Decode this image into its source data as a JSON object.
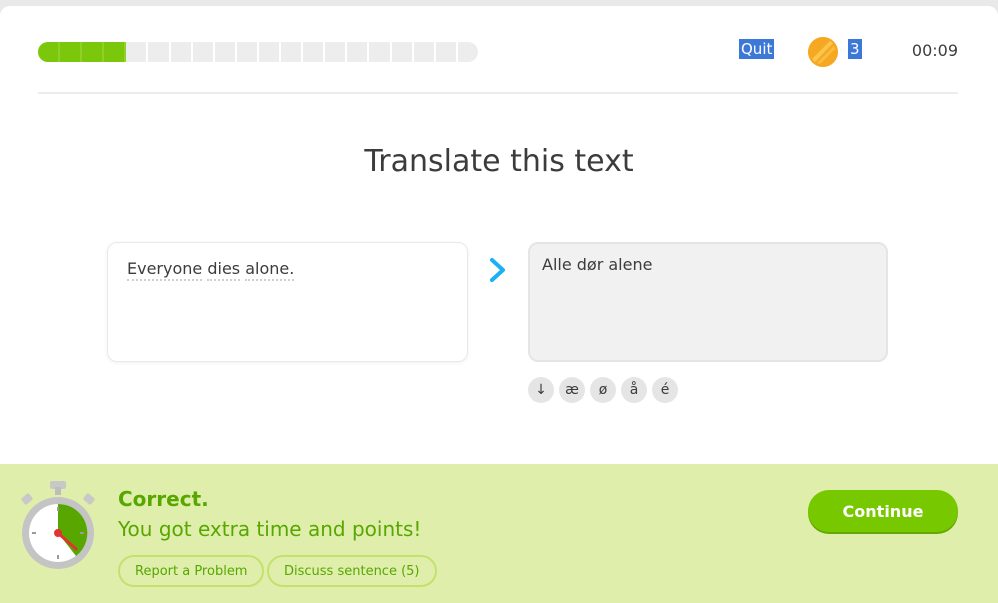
{
  "header": {
    "progress": {
      "total_segments": 20,
      "completed_segments": 4
    },
    "quit_label": "Quit",
    "coin_count": "3",
    "timer": "00:09"
  },
  "exercise": {
    "heading": "Translate this text",
    "prompt_words": [
      "Everyone",
      "dies",
      "alone."
    ],
    "answer_value": "Alle dør alene",
    "special_chars": [
      "↓",
      "æ",
      "ø",
      "å",
      "é"
    ]
  },
  "feedback": {
    "title": "Correct.",
    "subtitle": "You got extra time and points!",
    "report_label": "Report a Problem",
    "discuss_label": "Discuss sentence (5)",
    "continue_label": "Continue"
  },
  "colors": {
    "accent_green": "#78c800",
    "feedback_bg": "#dfeeab",
    "arrow_blue": "#1cb0f6",
    "coin": "#f7a823"
  },
  "icons": [
    "lingot-coin-icon",
    "chevron-right-icon",
    "stopwatch-icon"
  ]
}
